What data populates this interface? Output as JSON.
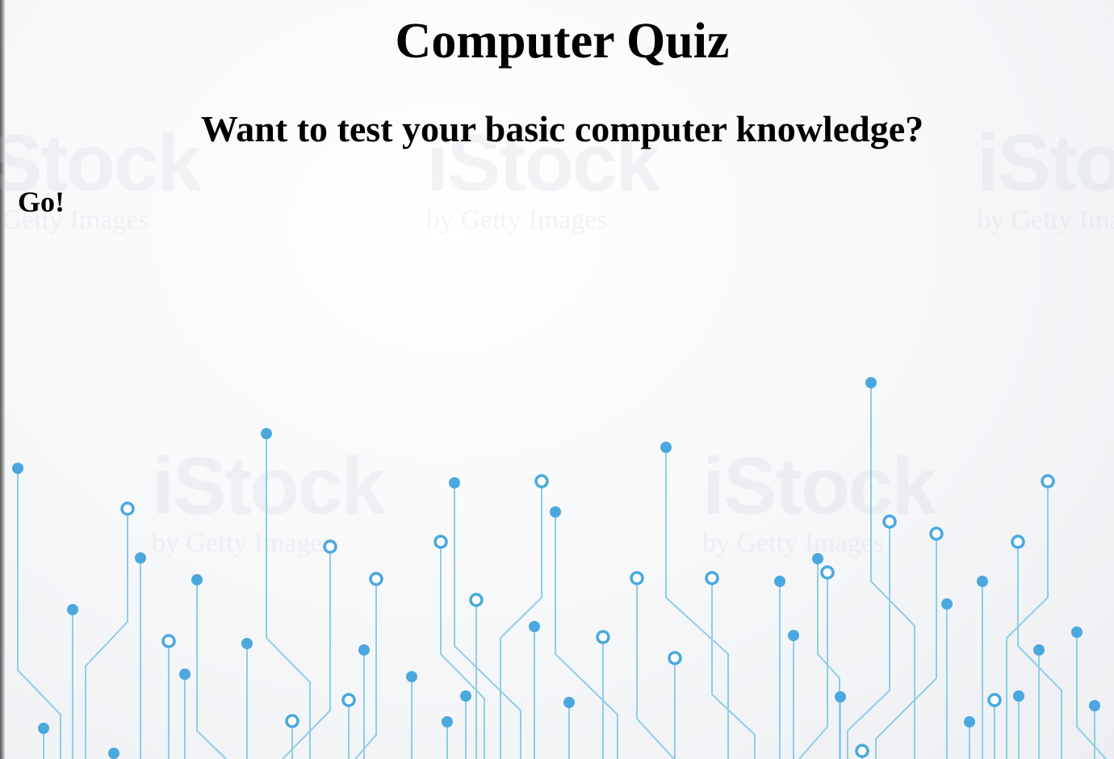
{
  "page": {
    "title": "Computer Quiz",
    "subtitle": "Want to test your basic computer knowledge?",
    "start_link": "Go!"
  },
  "background": {
    "watermark": {
      "brand": "iStock",
      "byline": "by Getty Images"
    },
    "circuit_color": "#4aa8de",
    "line_color": "#8fcde9"
  }
}
